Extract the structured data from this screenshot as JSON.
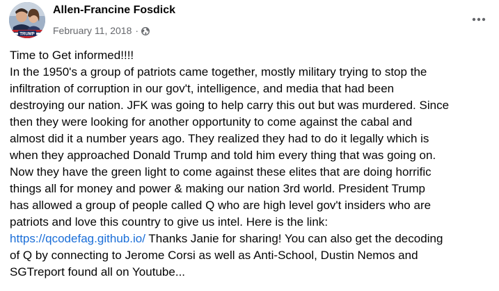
{
  "post": {
    "author": "Allen-Francine Fosdick",
    "date": "February 11, 2018",
    "separator": "·",
    "privacy_icon": "globe-icon",
    "more_icon": "more-horizontal-icon",
    "avatar_badge": "TRUMP",
    "lines": [
      {
        "text": "Time to Get informed!!!!"
      },
      {
        "text": "In the 1950's a group of patriots came together, mostly military trying to stop the"
      },
      {
        "text": "infiltration of corruption in our gov't, intelligence, and media that had been"
      },
      {
        "text": "destroying our nation. JFK was going to help carry this out but was murdered. Since"
      },
      {
        "text": "then they were looking for another opportunity to come against the cabal and"
      },
      {
        "text": "almost did it a number years ago. They realized they had to do it legally which is"
      },
      {
        "text": "when they approached Donald Trump and told him every thing that was going on."
      },
      {
        "text": "Now they have the green light to come against these elites that are doing horrific"
      },
      {
        "text": "things all for money and power & making our nation 3rd world. President Trump"
      },
      {
        "text": "has allowed a group of people called Q who are high level gov't insiders who are"
      },
      {
        "text": "patriots and love this country to give us intel. Here is the link:"
      },
      {
        "link": "https://qcodefag.github.io/",
        "text": " Thanks Janie for sharing! You can also get the decoding"
      },
      {
        "text": "of Q by connecting to Jerome Corsi as well as Anti-School, Dustin Nemos and"
      },
      {
        "text": "SGTreport found all on Youtube..."
      }
    ]
  },
  "colors": {
    "text": "#050505",
    "secondary": "#65676b",
    "link": "#1a6ed8"
  }
}
